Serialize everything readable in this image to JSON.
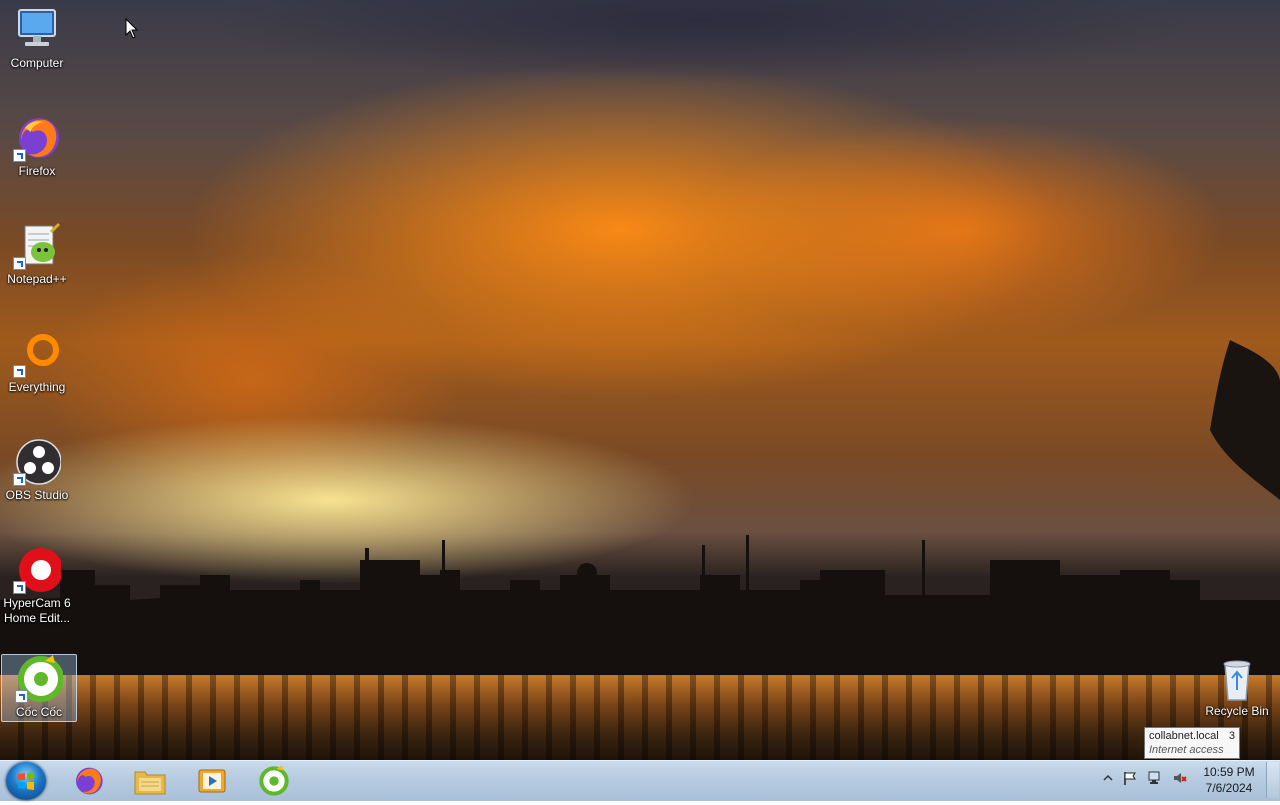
{
  "desktop": {
    "icons": [
      {
        "label": "Computer",
        "icon": "computer-icon"
      },
      {
        "label": "Firefox",
        "icon": "firefox-icon"
      },
      {
        "label": "Notepad++",
        "icon": "notepad-plus-plus-icon"
      },
      {
        "label": "Everything",
        "icon": "everything-icon"
      },
      {
        "label": "OBS Studio",
        "icon": "obs-studio-icon"
      },
      {
        "label": "HyperCam 6 Home Edit...",
        "icon": "hypercam-icon"
      },
      {
        "label": "Cốc Cốc",
        "icon": "coc-coc-icon"
      }
    ],
    "recycle_bin": {
      "label": "Recycle Bin",
      "icon": "recycle-bin-icon"
    }
  },
  "taskbar": {
    "pinned": [
      {
        "name": "firefox",
        "icon": "firefox-icon"
      },
      {
        "name": "file-explorer",
        "icon": "folder-icon"
      },
      {
        "name": "media-player",
        "icon": "media-player-icon"
      },
      {
        "name": "coc-coc",
        "icon": "coc-coc-icon"
      }
    ],
    "tray": {
      "tooltip_title": "collabnet.local",
      "tooltip_count": "3",
      "tooltip_sub": "Internet access",
      "time": "10:59 PM",
      "date": "7/6/2024"
    }
  },
  "colors": {
    "taskbar": "#b6cbe0",
    "sky_orange": "#d9741a",
    "selection": "#add8ff"
  }
}
